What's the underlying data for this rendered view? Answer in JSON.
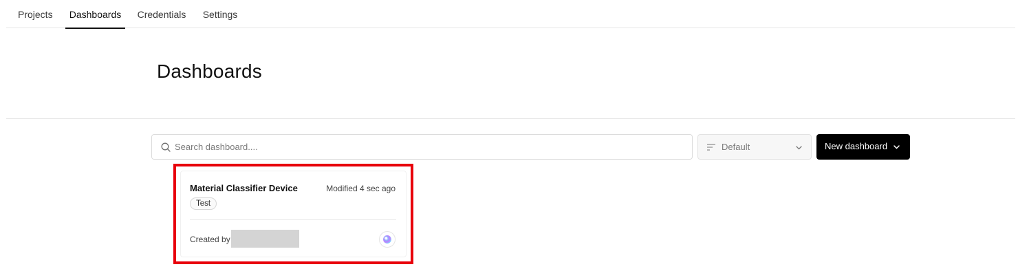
{
  "nav": {
    "tabs": [
      {
        "label": "Projects"
      },
      {
        "label": "Dashboards"
      },
      {
        "label": "Credentials"
      },
      {
        "label": "Settings"
      }
    ],
    "active_tab": "Dashboards"
  },
  "page": {
    "title": "Dashboards"
  },
  "toolbar": {
    "search_placeholder": "Search dashboard....",
    "search_value": "",
    "sort_label": "Default",
    "new_button_label": "New dashboard"
  },
  "dashboards": [
    {
      "title": "Material Classifier Device",
      "modified": "Modified 4 sec ago",
      "tag": "Test",
      "created_by_label": "Created by"
    }
  ],
  "colors": {
    "accent": "#000000",
    "highlight": "#e8000b",
    "border": "#dcdcdc"
  },
  "icons": {
    "search": "search-icon",
    "sort": "sort-lines-icon",
    "chevron": "chevron-down-icon",
    "avatar": "avatar-icon"
  }
}
